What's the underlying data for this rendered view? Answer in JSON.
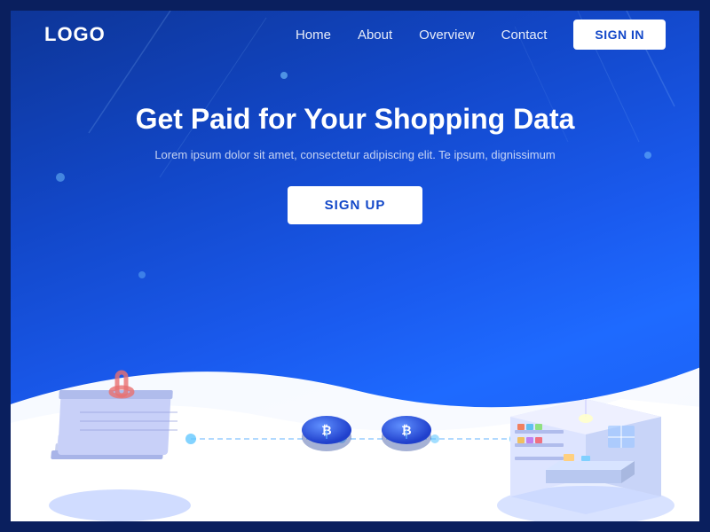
{
  "nav": {
    "logo": "LOGO",
    "links": [
      {
        "label": "Home",
        "id": "home"
      },
      {
        "label": "About",
        "id": "about"
      },
      {
        "label": "Overview",
        "id": "overview"
      },
      {
        "label": "Contact",
        "id": "contact"
      }
    ],
    "signin_label": "SIGN IN"
  },
  "hero": {
    "title": "Get Paid for Your Shopping Data",
    "subtitle": "Lorem ipsum dolor sit amet, consectetur adipiscing elit. Te ipsum, dignissimum",
    "cta_label": "SIGN UP"
  },
  "colors": {
    "bg_dark": "#0a2a6e",
    "bg_mid": "#1247c8",
    "bg_light": "#1a5aee",
    "white": "#ffffff",
    "accent": "#f5c842"
  }
}
